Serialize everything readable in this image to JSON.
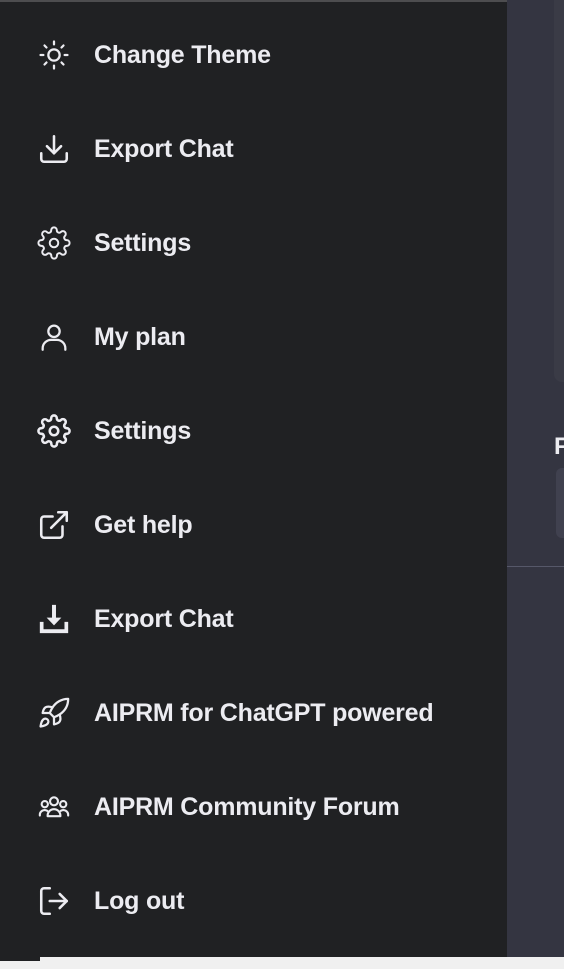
{
  "menu": {
    "items": [
      {
        "label": "Change Theme",
        "icon": "sun-icon"
      },
      {
        "label": "Export Chat",
        "icon": "download-icon"
      },
      {
        "label": "Settings",
        "icon": "gear-icon"
      },
      {
        "label": "My plan",
        "icon": "user-icon"
      },
      {
        "label": "Settings",
        "icon": "gear-icon"
      },
      {
        "label": "Get help",
        "icon": "external-link-icon"
      },
      {
        "label": "Export Chat",
        "icon": "download-tray-icon"
      },
      {
        "label": "AIPRM for ChatGPT powered",
        "icon": "rocket-icon"
      },
      {
        "label": "AIPRM Community Forum",
        "icon": "users-icon"
      },
      {
        "label": "Log out",
        "icon": "logout-icon"
      }
    ]
  },
  "right_panel": {
    "partial_char": "F"
  },
  "colors": {
    "menu_background": "#202123",
    "text": "#ececf1",
    "page_background": "#343541"
  }
}
